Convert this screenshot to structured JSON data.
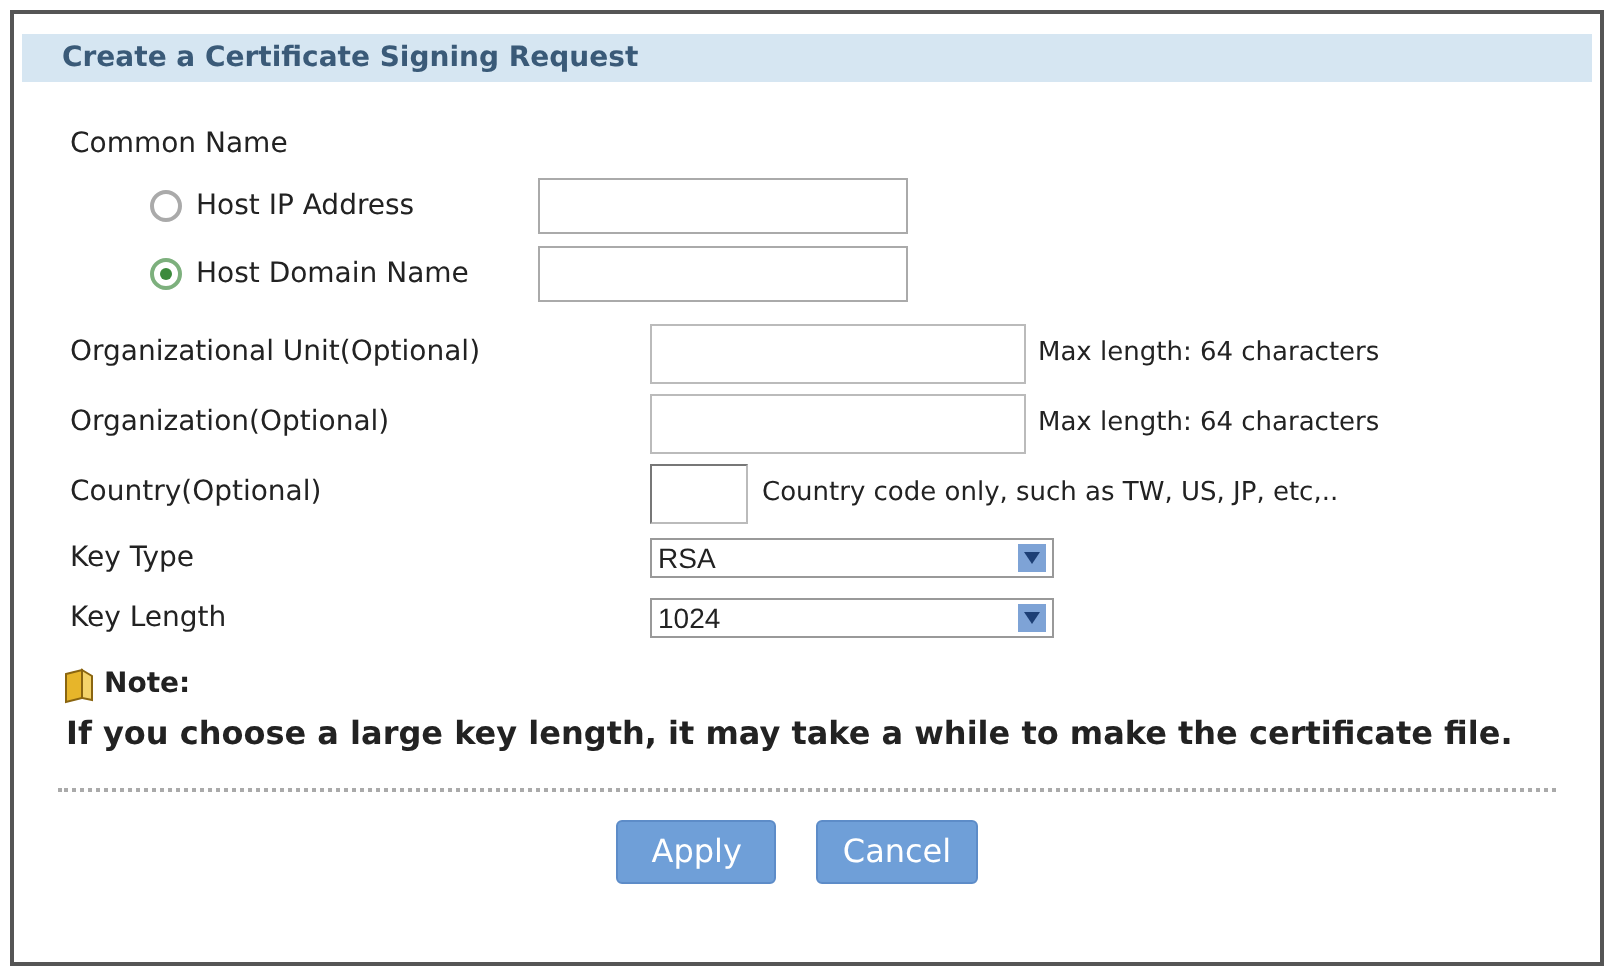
{
  "panel": {
    "title": "Create a Certificate Signing Request"
  },
  "common_name": {
    "label": "Common Name",
    "options": [
      {
        "label": "Host IP Address",
        "selected": false
      },
      {
        "label": "Host Domain Name",
        "selected": true
      }
    ]
  },
  "fields": [
    {
      "kind": "text",
      "label": "Organizational Unit(Optional)",
      "hint": "Max length: 64 characters"
    },
    {
      "kind": "text",
      "label": "Organization(Optional)",
      "hint": "Max length: 64 characters"
    },
    {
      "kind": "short",
      "label": "Country(Optional)",
      "hint": "Country code only, such as TW, US, JP, etc,.."
    },
    {
      "kind": "select",
      "label": "Key Type",
      "value": "RSA"
    },
    {
      "kind": "select",
      "label": "Key Length",
      "value": "1024"
    }
  ],
  "note": {
    "title": "Note:",
    "text": "If you choose a large key length, it may take a while to make the certificate file."
  },
  "buttons": [
    "Apply",
    "Cancel"
  ]
}
